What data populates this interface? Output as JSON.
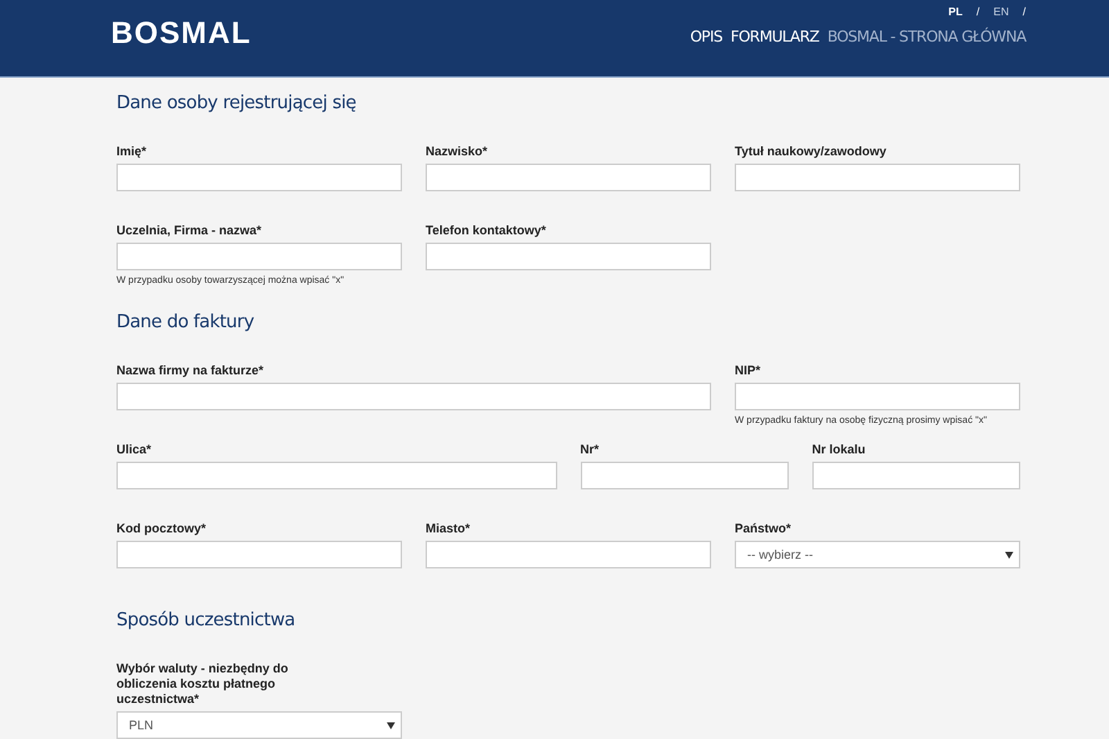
{
  "header": {
    "logo": "BOSMAL",
    "languages": [
      {
        "label": "PL",
        "selected": true
      },
      {
        "label": "EN",
        "selected": false
      }
    ],
    "separator": "/",
    "nav": [
      {
        "label": "OPIS",
        "muted": false
      },
      {
        "label": "FORMULARZ",
        "muted": false
      },
      {
        "label": "BOSMAL - STRONA GŁÓWNA",
        "muted": true
      }
    ]
  },
  "sections": [
    {
      "title": "Dane osoby rejestrującej się",
      "fields": [
        {
          "label": "Imię*",
          "kind": "text"
        },
        {
          "label": "Nazwisko*",
          "kind": "text"
        },
        {
          "label": "Tytuł naukowy/zawodowy",
          "kind": "text"
        },
        {
          "label": "Uczelnia, Firma - nazwa*",
          "kind": "text",
          "hint": "W przypadku osoby towarzyszącej można wpisać \"x\""
        },
        {
          "label": "Telefon kontaktowy*",
          "kind": "text"
        }
      ]
    },
    {
      "title": "Dane do faktury",
      "fields": [
        {
          "label": "Nazwa firmy na fakturze*",
          "kind": "text"
        },
        {
          "label": "NIP*",
          "kind": "text",
          "hint": "W przypadku faktury na osobę fizyczną prosimy wpisać \"x\""
        },
        {
          "label": "Ulica*",
          "kind": "text"
        },
        {
          "label": "Nr*",
          "kind": "text"
        },
        {
          "label": "Nr lokalu",
          "kind": "text"
        },
        {
          "label": "Kod pocztowy*",
          "kind": "text"
        },
        {
          "label": "Miasto*",
          "kind": "text"
        },
        {
          "label": "Państwo*",
          "kind": "select",
          "value": "-- wybierz --"
        }
      ]
    },
    {
      "title": "Sposób uczestnictwa",
      "fields": [
        {
          "label": "Wybór waluty - niezbędny do obliczenia kosztu płatnego uczestnictwa*",
          "kind": "select",
          "value": "PLN"
        }
      ]
    }
  ]
}
